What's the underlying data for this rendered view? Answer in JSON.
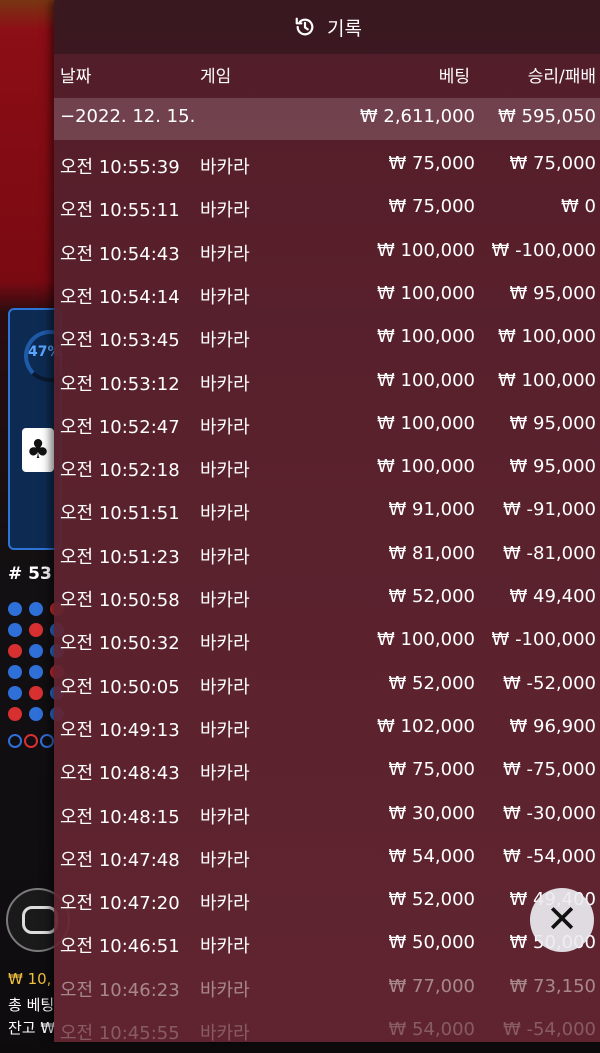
{
  "game_bg": {
    "progress_percent": "47%",
    "card_suit": "♣",
    "round_label": "# 53",
    "balance_prefix": "₩ 10,",
    "total_bet_label": "총 베팅",
    "balance_label": "잔고 ₩"
  },
  "panel": {
    "title": "기록",
    "columns": {
      "date": "날짜",
      "game": "게임",
      "bet": "베팅",
      "result": "승리/패배"
    },
    "summary": {
      "date": "−2022. 12. 15.",
      "bet": "₩ 2,611,000",
      "result": "₩ 595,050"
    },
    "rows": [
      {
        "time": "오전 10:55:39",
        "game": "바카라",
        "bet": "₩ 75,000",
        "result": "₩ 75,000"
      },
      {
        "time": "오전 10:55:11",
        "game": "바카라",
        "bet": "₩ 75,000",
        "result": "₩ 0"
      },
      {
        "time": "오전 10:54:43",
        "game": "바카라",
        "bet": "₩ 100,000",
        "result": "₩ -100,000"
      },
      {
        "time": "오전 10:54:14",
        "game": "바카라",
        "bet": "₩ 100,000",
        "result": "₩ 95,000"
      },
      {
        "time": "오전 10:53:45",
        "game": "바카라",
        "bet": "₩ 100,000",
        "result": "₩ 100,000"
      },
      {
        "time": "오전 10:53:12",
        "game": "바카라",
        "bet": "₩ 100,000",
        "result": "₩ 100,000"
      },
      {
        "time": "오전 10:52:47",
        "game": "바카라",
        "bet": "₩ 100,000",
        "result": "₩ 95,000"
      },
      {
        "time": "오전 10:52:18",
        "game": "바카라",
        "bet": "₩ 100,000",
        "result": "₩ 95,000"
      },
      {
        "time": "오전 10:51:51",
        "game": "바카라",
        "bet": "₩ 91,000",
        "result": "₩ -91,000"
      },
      {
        "time": "오전 10:51:23",
        "game": "바카라",
        "bet": "₩ 81,000",
        "result": "₩ -81,000"
      },
      {
        "time": "오전 10:50:58",
        "game": "바카라",
        "bet": "₩ 52,000",
        "result": "₩ 49,400"
      },
      {
        "time": "오전 10:50:32",
        "game": "바카라",
        "bet": "₩ 100,000",
        "result": "₩ -100,000"
      },
      {
        "time": "오전 10:50:05",
        "game": "바카라",
        "bet": "₩ 52,000",
        "result": "₩ -52,000"
      },
      {
        "time": "오전 10:49:13",
        "game": "바카라",
        "bet": "₩ 102,000",
        "result": "₩ 96,900"
      },
      {
        "time": "오전 10:48:43",
        "game": "바카라",
        "bet": "₩ 75,000",
        "result": "₩ -75,000"
      },
      {
        "time": "오전 10:48:15",
        "game": "바카라",
        "bet": "₩ 30,000",
        "result": "₩ -30,000"
      },
      {
        "time": "오전 10:47:48",
        "game": "바카라",
        "bet": "₩ 54,000",
        "result": "₩ -54,000"
      },
      {
        "time": "오전 10:47:20",
        "game": "바카라",
        "bet": "₩ 52,000",
        "result": "₩ 49,400"
      },
      {
        "time": "오전 10:46:51",
        "game": "바카라",
        "bet": "₩ 50,000",
        "result": "₩ 50,000"
      },
      {
        "time": "오전 10:46:23",
        "game": "바카라",
        "bet": "₩ 77,000",
        "result": "₩ 73,150"
      },
      {
        "time": "오전 10:45:55",
        "game": "바카라",
        "bet": "₩ 54,000",
        "result": "₩ -54,000"
      }
    ],
    "close_symbol": "✕"
  },
  "icons": {
    "history": "history-clock-icon",
    "close": "close-icon",
    "chip": "chip-icon"
  }
}
